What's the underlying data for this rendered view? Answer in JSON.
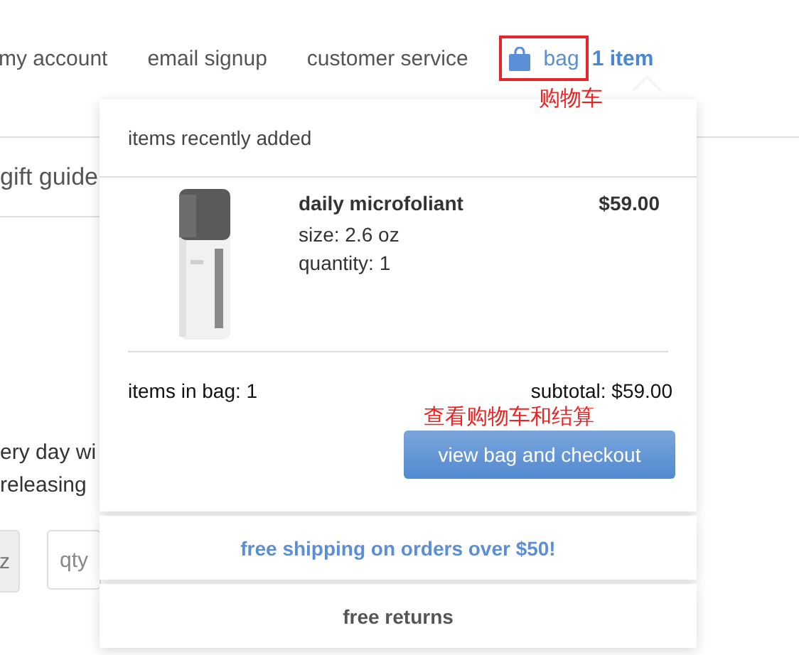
{
  "nav": {
    "links": [
      "my account",
      "email signup",
      "customer service"
    ],
    "bag_label": "bag",
    "bag_count": "1 item",
    "bag_annotation": "购物车"
  },
  "page": {
    "menu_item": "gift guide",
    "text_lines": [
      "ery day wi",
      "releasing"
    ],
    "button_fragment": "z",
    "qty_placeholder": "qty"
  },
  "bag_popup": {
    "heading": "items recently added",
    "items": [
      {
        "name": "daily microfoliant",
        "size": "size: 2.6 oz",
        "quantity": "quantity: 1",
        "price": "$59.00"
      }
    ],
    "items_in_bag": "items in bag: 1",
    "subtotal": "subtotal: $59.00",
    "checkout_annotation": "查看购物车和结算",
    "checkout_button": "view bag and checkout",
    "promos": [
      {
        "text": "free shipping on orders over $50!",
        "kind": "highlight"
      },
      {
        "text": "free returns",
        "kind": "plain"
      }
    ]
  }
}
